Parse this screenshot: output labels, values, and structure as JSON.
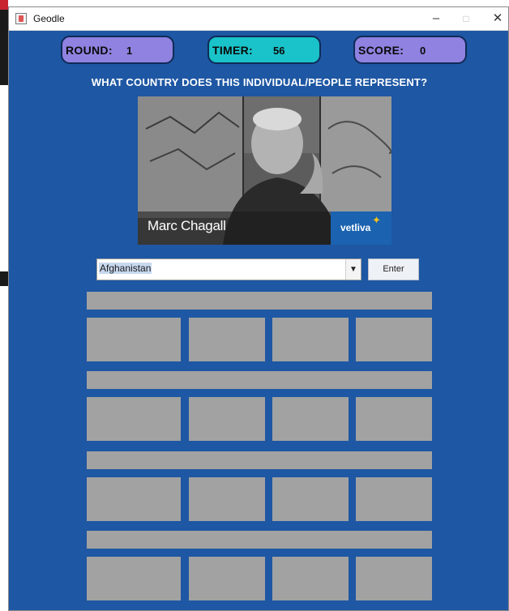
{
  "window": {
    "title": "Geodle",
    "controls": {
      "minimize": "–",
      "maximize": "□",
      "close": "✕"
    }
  },
  "status": {
    "round_label": "ROUND:",
    "round_value": "1",
    "timer_label": "TIMER:",
    "timer_value": "56",
    "score_label": "SCORE:",
    "score_value": "0"
  },
  "question": "WHAT COUNTRY DOES THIS INDIVIDUAL/PEOPLE REPRESENT?",
  "photo": {
    "caption": "Marc Chagall",
    "watermark": "vetliva"
  },
  "answer": {
    "selected_country": "Afghanistan",
    "enter_label": "Enter"
  },
  "guess_rows": [
    {
      "hint": "",
      "cells": [
        "",
        "",
        "",
        ""
      ]
    },
    {
      "hint": "",
      "cells": [
        "",
        "",
        "",
        ""
      ]
    },
    {
      "hint": "",
      "cells": [
        "",
        "",
        "",
        ""
      ]
    },
    {
      "hint": "",
      "cells": [
        "",
        "",
        "",
        ""
      ]
    }
  ],
  "colors": {
    "window_bg": "#1e57a3",
    "pill_round_score": "#8f82e0",
    "pill_timer": "#19c3c9",
    "guess_slot": "#a2a2a2"
  },
  "icons": {
    "app": "java-cup-icon",
    "dropdown": "chevron-down-icon"
  }
}
